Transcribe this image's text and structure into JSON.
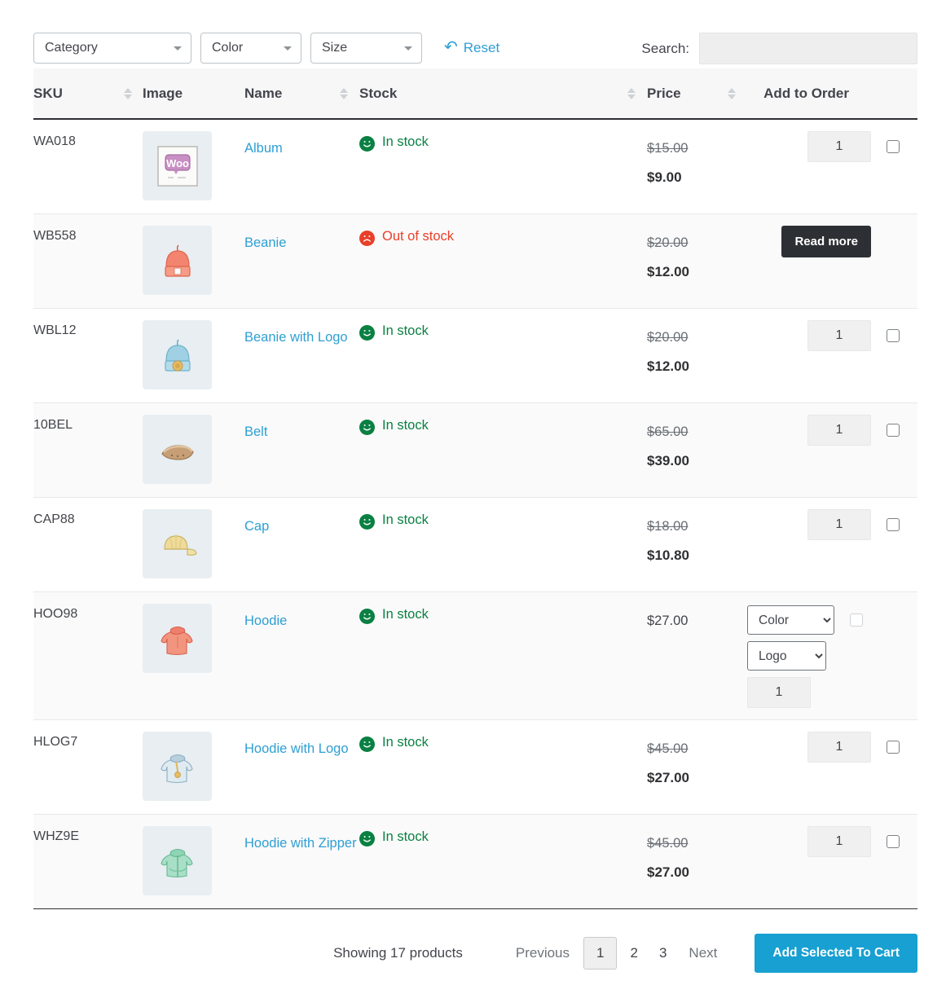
{
  "filters": {
    "category": "Category",
    "color": "Color",
    "size": "Size",
    "reset": "Reset",
    "reset_icon": "undo-arrow-icon"
  },
  "search": {
    "label": "Search:",
    "value": "",
    "placeholder": ""
  },
  "table": {
    "headers": {
      "sku": "SKU",
      "image": "Image",
      "name": "Name",
      "stock": "Stock",
      "price": "Price",
      "order": "Add to Order"
    },
    "rows": [
      {
        "sku": "WA018",
        "image_icon": "album-thumbnail",
        "name": "Album",
        "stock_status": "In stock",
        "stock_icon": "smiley-face-icon",
        "price_old": "$15.00",
        "price_new": "$9.00",
        "qty": "1",
        "action": "qty"
      },
      {
        "sku": "WB558",
        "image_icon": "beanie-thumbnail",
        "name": "Beanie",
        "stock_status": "Out of stock",
        "stock_icon": "sad-face-icon",
        "price_old": "$20.00",
        "price_new": "$12.00",
        "read_more": "Read more",
        "action": "readmore"
      },
      {
        "sku": "WBL12",
        "image_icon": "beanie-with-logo-thumbnail",
        "name": "Beanie with Logo",
        "stock_status": "In stock",
        "stock_icon": "smiley-face-icon",
        "price_old": "$20.00",
        "price_new": "$12.00",
        "qty": "1",
        "action": "qty"
      },
      {
        "sku": "10BEL",
        "image_icon": "belt-thumbnail",
        "name": "Belt",
        "stock_status": "In stock",
        "stock_icon": "smiley-face-icon",
        "price_old": "$65.00",
        "price_new": "$39.00",
        "qty": "1",
        "action": "qty"
      },
      {
        "sku": "CAP88",
        "image_icon": "cap-thumbnail",
        "name": "Cap",
        "stock_status": "In stock",
        "stock_icon": "smiley-face-icon",
        "price_old": "$18.00",
        "price_new": "$10.80",
        "qty": "1",
        "action": "qty"
      },
      {
        "sku": "HOO98",
        "image_icon": "hoodie-thumbnail",
        "name": "Hoodie",
        "stock_status": "In stock",
        "stock_icon": "smiley-face-icon",
        "price_single": "$27.00",
        "qty": "1",
        "action": "variations",
        "variations": [
          {
            "name": "Color",
            "selected": "Color"
          },
          {
            "name": "Logo",
            "selected": "Logo"
          }
        ]
      },
      {
        "sku": "HLOG7",
        "image_icon": "hoodie-with-logo-thumbnail",
        "name": "Hoodie with Logo",
        "stock_status": "In stock",
        "stock_icon": "smiley-face-icon",
        "price_old": "$45.00",
        "price_new": "$27.00",
        "qty": "1",
        "action": "qty"
      },
      {
        "sku": "WHZ9E",
        "image_icon": "hoodie-with-zipper-thumbnail",
        "name": "Hoodie with Zipper",
        "stock_status": "In stock",
        "stock_icon": "smiley-face-icon",
        "price_old": "$45.00",
        "price_new": "$27.00",
        "qty": "1",
        "action": "qty"
      }
    ]
  },
  "footer": {
    "showing": "Showing 17 products",
    "previous": "Previous",
    "pages": [
      "1",
      "2",
      "3"
    ],
    "current_page": "1",
    "next": "Next",
    "add_to_cart": "Add Selected To Cart"
  },
  "colors": {
    "link": "#2e9fd4",
    "in_stock": "#0a8043",
    "out_of_stock": "#e8402a",
    "cart_button": "#17a0d1",
    "read_more_button": "#2c2f33",
    "thumb_bg": "#e8eef2"
  }
}
